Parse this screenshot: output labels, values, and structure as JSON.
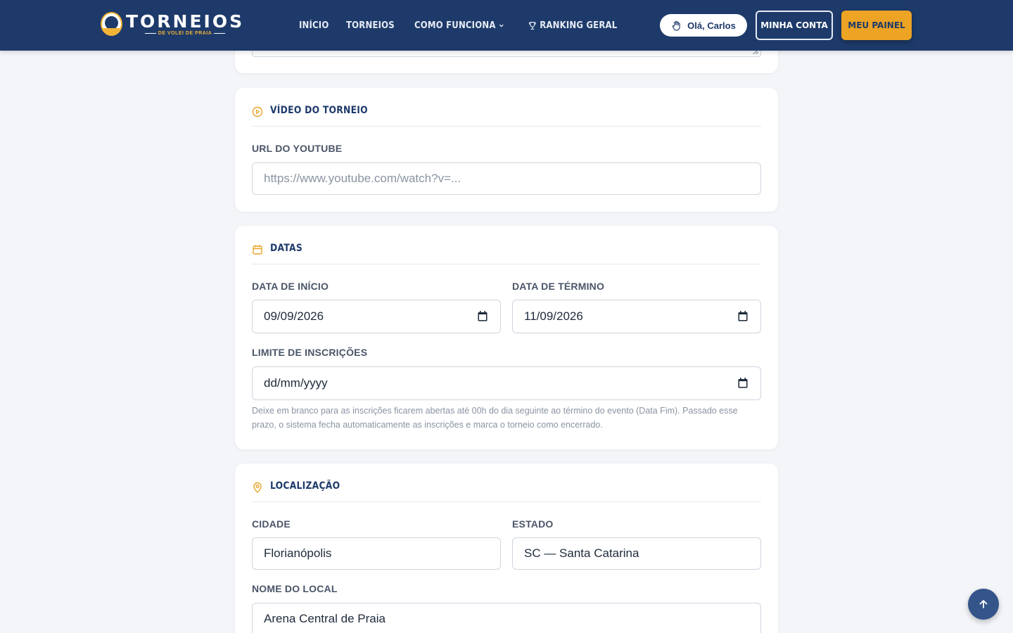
{
  "header": {
    "logo": {
      "title": "TORNEIOS",
      "subtitle": "DE VOLEI DE PRAIA"
    },
    "nav": [
      {
        "label": "INÍCIO"
      },
      {
        "label": "TORNEIOS"
      },
      {
        "label": "COMO FUNCIONA",
        "icon": "chevron-down-icon"
      },
      {
        "label": "RANKING GERAL",
        "icon": "trophy-icon"
      }
    ],
    "greeting": "Olá, Carlos",
    "account_button": "MINHA CONTA",
    "panel_button": "MEU PAINEL"
  },
  "sections": {
    "video": {
      "title": "VÍDEO DO TORNEIO",
      "icon": "play-circle-icon",
      "youtube_label": "URL DO YOUTUBE",
      "youtube_value": "",
      "youtube_placeholder": "https://www.youtube.com/watch?v=..."
    },
    "dates": {
      "title": "DATAS",
      "icon": "calendar-icon",
      "start_label": "DATA DE INÍCIO",
      "start_value": "09/09/2026",
      "end_label": "DATA DE TÉRMINO",
      "end_value": "11/09/2026",
      "limit_label": "LIMITE DE INSCRIÇÕES",
      "limit_value": "dd/mm/yyyy",
      "limit_help": "Deixe em branco para as inscrições ficarem abertas até 00h do dia seguinte ao término do evento (Data Fim). Passado esse prazo, o sistema fecha automaticamente as inscrições e marca o torneio como encerrado."
    },
    "location": {
      "title": "LOCALIZAÇÃO",
      "icon": "map-pin-icon",
      "city_label": "CIDADE",
      "city_value": "Florianópolis",
      "state_label": "ESTADO",
      "state_value": "SC — Santa Catarina",
      "venue_label": "NOME DO LOCAL",
      "venue_value": "Arena Central de Praia"
    }
  },
  "colors": {
    "header_bg": "#1d3a6a",
    "accent": "#eda323",
    "page_bg": "#f3f5f8"
  }
}
